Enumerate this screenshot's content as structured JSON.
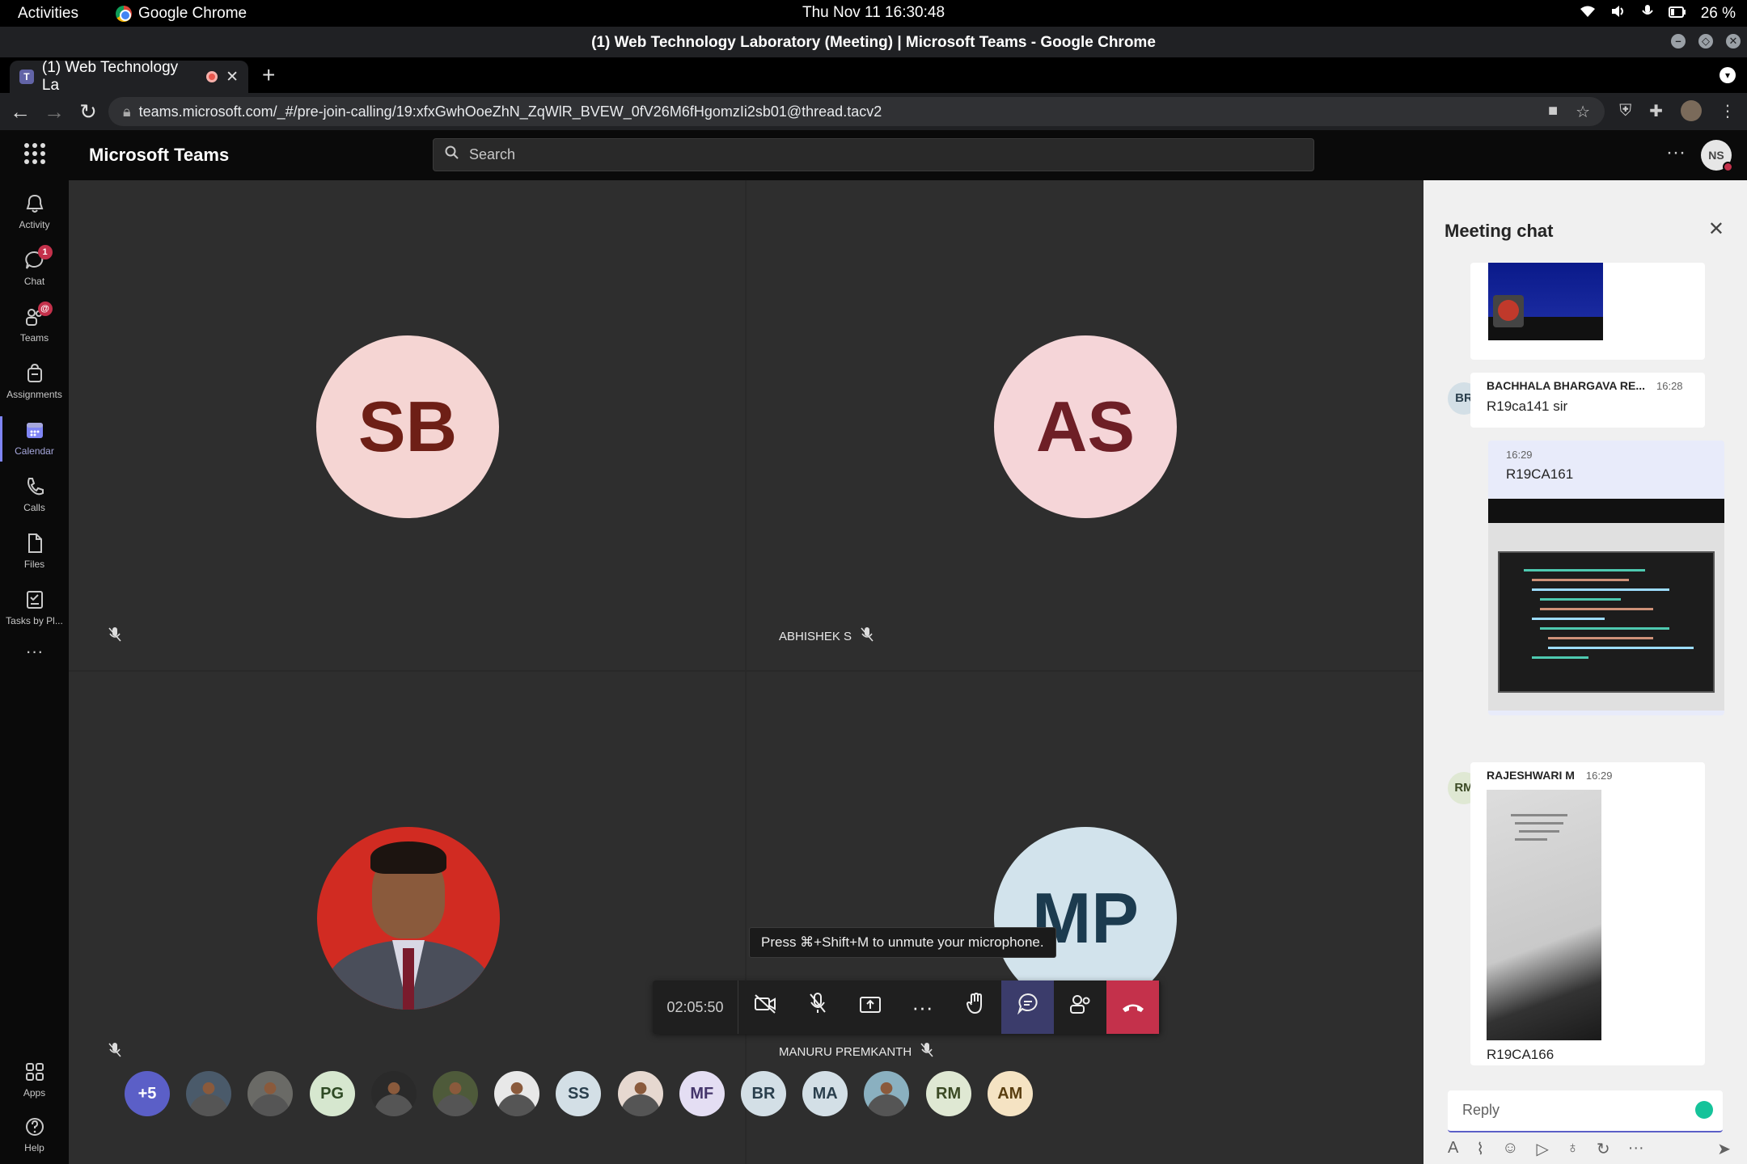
{
  "gnome": {
    "activities": "Activities",
    "app_name": "Google Chrome",
    "clock": "Thu Nov 11  16:30:48",
    "battery": "26 %"
  },
  "window": {
    "title": "(1) Web Technology Laboratory (Meeting) | Microsoft Teams - Google Chrome"
  },
  "tabs": [
    {
      "label": "(1) Web Technology La"
    }
  ],
  "address_bar": {
    "url": "teams.microsoft.com/_#/pre-join-calling/19:xfxGwhOoeZhN_ZqWlR_BVEW_0fV26M6fHgomzIi2sb01@thread.tacv2"
  },
  "teams_header": {
    "app_title": "Microsoft Teams",
    "search_placeholder": "Search",
    "user_initials": "NS"
  },
  "rail": [
    {
      "label": "Activity",
      "icon": "bell-icon"
    },
    {
      "label": "Chat",
      "icon": "chat-icon",
      "badge": "1"
    },
    {
      "label": "Teams",
      "icon": "teams-icon",
      "badge": "@"
    },
    {
      "label": "Assignments",
      "icon": "assignments-icon"
    },
    {
      "label": "Calendar",
      "icon": "calendar-icon",
      "active": true
    },
    {
      "label": "Calls",
      "icon": "phone-icon"
    },
    {
      "label": "Files",
      "icon": "file-icon"
    },
    {
      "label": "Tasks by Pl...",
      "icon": "tasks-icon"
    },
    {
      "label": "Apps",
      "icon": "apps-icon"
    },
    {
      "label": "Help",
      "icon": "help-icon"
    }
  ],
  "tiles": [
    {
      "initials": "SB",
      "name": "",
      "bg": "#f5d5d3",
      "fg": "#6e1f16"
    },
    {
      "initials": "AS",
      "name": "ABHISHEK S",
      "bg": "#f5d5d8",
      "fg": "#6e1f26"
    },
    {
      "initials": "",
      "name": "",
      "photo": true
    },
    {
      "initials": "MP",
      "name": "MANURU PREMKANTH",
      "bg": "#d2e3ec",
      "fg": "#1c3b4f"
    }
  ],
  "tooltip": "Press ⌘+Shift+M to unmute your microphone.",
  "call_controls": {
    "timer": "02:05:50"
  },
  "participants": [
    {
      "label": "+5",
      "bg": "#5b5fc7",
      "fg": "#fff"
    },
    {
      "label": "",
      "bg": "#4a5a6a",
      "photo": true
    },
    {
      "label": "",
      "bg": "#6a6a66",
      "photo": true
    },
    {
      "label": "PG",
      "bg": "#d6e7cf",
      "fg": "#2e4a24"
    },
    {
      "label": "",
      "bg": "#2a2a2a",
      "photo": true
    },
    {
      "label": "",
      "bg": "#4e5a3a",
      "photo": true
    },
    {
      "label": "",
      "bg": "#e8e8e8",
      "photo": true
    },
    {
      "label": "SS",
      "bg": "#d3dfe6",
      "fg": "#2a3f4d"
    },
    {
      "label": "",
      "bg": "#e6d8d0",
      "photo": true
    },
    {
      "label": "MF",
      "bg": "#e4def3",
      "fg": "#44356b"
    },
    {
      "label": "BR",
      "bg": "#d3dfe6",
      "fg": "#2a3f4d"
    },
    {
      "label": "MA",
      "bg": "#d3dfe6",
      "fg": "#2a3f4d"
    },
    {
      "label": "",
      "bg": "#8ab0c0",
      "photo": true
    },
    {
      "label": "RM",
      "bg": "#dfe8d3",
      "fg": "#3b4a24"
    },
    {
      "label": "AM",
      "bg": "#f5e3c3",
      "fg": "#5a3e10"
    }
  ],
  "chat": {
    "title": "Meeting chat",
    "messages": [
      {
        "initials": "BR",
        "sender": "BACHHALA BHARGAVA RE...",
        "time": "16:28",
        "text": "R19ca141 sir"
      },
      {
        "initials": "",
        "sender": "",
        "time": "16:29",
        "text": "R19CA161",
        "mine": true
      },
      {
        "initials": "RM",
        "sender": "RAJESHWARI M",
        "time": "16:29",
        "text": "R19CA166"
      }
    ],
    "reply_placeholder": "Reply"
  }
}
